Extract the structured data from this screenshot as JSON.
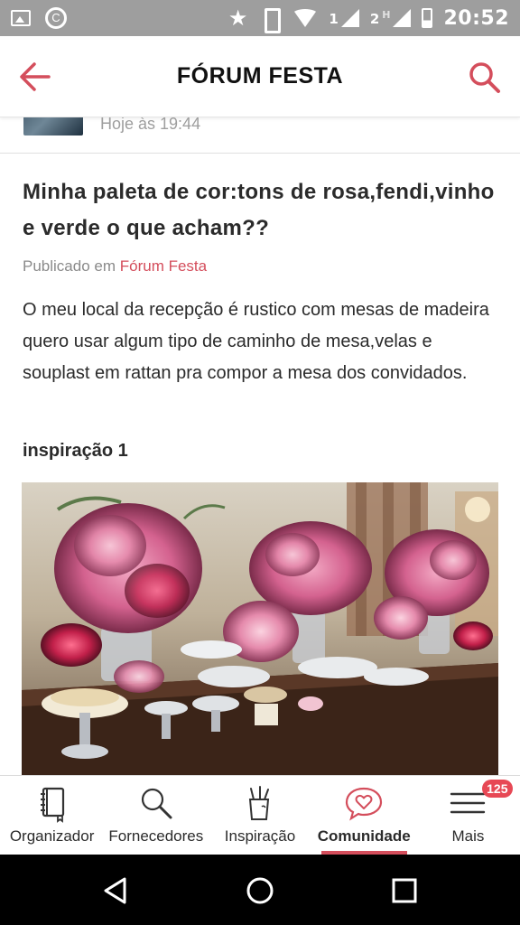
{
  "status_bar": {
    "signal_1": "1",
    "signal_2": "2",
    "network": "H",
    "time": "20:52",
    "icons": [
      "image-icon",
      "c-app-icon",
      "star-icon",
      "vibrate-icon",
      "wifi-icon",
      "signal-icon",
      "battery-icon"
    ]
  },
  "header": {
    "title": "FÓRUM FESTA",
    "accent_color": "#d44e5c",
    "back_icon": "back-arrow-icon",
    "search_icon": "search-icon"
  },
  "author": {
    "date": "Hoje às 19:44"
  },
  "post": {
    "title": "Minha paleta de cor:tons de rosa,fendi,vinho e verde o que acham??",
    "meta_prefix": "Publicado em ",
    "meta_link": "Fórum Festa",
    "body": "O meu local da recepção é rustico com mesas de madeira quero usar algum tipo de caminho de mesa,velas e souplast em rattan pra compor a mesa dos convidados.",
    "subheading": "inspiração 1"
  },
  "bottom_nav": {
    "items": [
      {
        "label": "Organizador",
        "icon": "notebook-icon"
      },
      {
        "label": "Fornecedores",
        "icon": "magnifier-icon"
      },
      {
        "label": "Inspiração",
        "icon": "cup-pencils-icon"
      },
      {
        "label": "Comunidade",
        "icon": "heart-chat-icon",
        "active": true
      },
      {
        "label": "Mais",
        "icon": "menu-icon",
        "badge": "125"
      }
    ]
  },
  "system_nav": {
    "icons": [
      "back-triangle-icon",
      "home-circle-icon",
      "recents-square-icon"
    ]
  }
}
